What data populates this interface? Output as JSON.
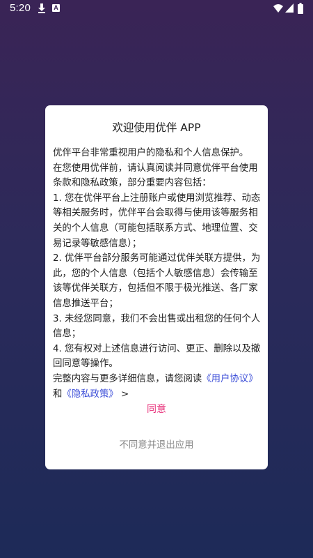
{
  "status_bar": {
    "time": "5:20",
    "icons": [
      "download-icon",
      "a-icon",
      "wifi-icon",
      "signal-icon",
      "battery-icon"
    ],
    "a_icon_glyph": "A"
  },
  "dialog": {
    "title": "欢迎使用优伴 APP",
    "intro_1": "优伴平台非常重视用户的隐私和个人信息保护。",
    "intro_2": "在您使用优伴前，请认真阅读并同意优伴平台使用条款和隐私政策，部分重要内容包括：",
    "item_1": "1. 您在优伴平台上注册账户或使用浏览推荐、动态等相关服务时，优伴平台会取得与使用该等服务相关的个人信息（可能包括联系方式、地理位置、交易记录等敏感信息）；",
    "item_2": "2. 优伴平台部分服务可能通过优伴关联方提供，为此，您的个人信息（包括个人敏感信息）会传输至该等优伴关联方，包括但不限于极光推送、各厂家信息推送平台；",
    "item_3": "3. 未经您同意，我们不会出售或出租您的任何个人信息；",
    "item_4": "4. 您有权对上述信息进行访问、更正、删除以及撤回同意等操作。",
    "footer_prefix": "完整内容与更多详细信息，请您阅读",
    "user_agreement_link": "《用户协议》",
    "footer_and": "和",
    "privacy_policy_link": "《隐私政策》",
    "footer_suffix": " >",
    "agree_label": "同意",
    "disagree_label": "不同意并退出应用"
  },
  "colors": {
    "background_top": "#3a2456",
    "background_bottom": "#1d2a58",
    "link": "#3b4dd8",
    "agree": "#e8307a",
    "disagree": "#8a8a8a"
  }
}
